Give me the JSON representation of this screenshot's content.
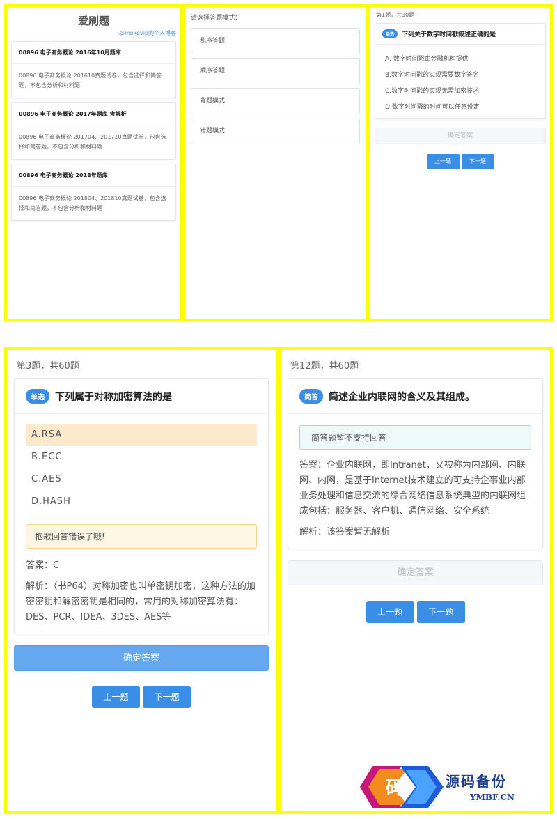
{
  "screen1": {
    "app_title": "爱刷题",
    "subtitle": "@mokevip的个人博客",
    "banks": [
      {
        "title": "00896 电子商务概论 2016年10月题库",
        "desc": "00896 电子商务概论 201610真题试卷，包含选择和简答题，不包含分析和材料题"
      },
      {
        "title": "00896 电子商务概论 2017年题库 含解析",
        "desc": "00896 电子商务概论 201704、201710真题试卷，包含选择和简答题，不包含分析和材料题"
      },
      {
        "title": "00896 电子商务概论 2018年题库",
        "desc": "00896 电子商务概论 201804、201810真题试卷，包含选择和简答题，不包含分析和材料题"
      }
    ]
  },
  "screen2": {
    "prompt": "请选择答题模式：",
    "modes": [
      "乱序答题",
      "顺序答题",
      "背题模式",
      "错题模式"
    ]
  },
  "screen3": {
    "counter": "第1题，共30题",
    "tag": "单选",
    "question": "下列关于数字时间戳叙述正确的是",
    "options": [
      "A. 数字时间戳由金融机构提供",
      "B.数字时间戳的实现需要数字签名",
      "C.数字时间戳的实现无需加密技术",
      "D.数字时间戳的时间可以任意设定"
    ],
    "confirm": "确定答案",
    "prev": "上一题",
    "next": "下一题"
  },
  "screen4": {
    "counter": "第3题，共60题",
    "tag": "单选",
    "question": "下列属于对称加密算法的是",
    "options": [
      "A.RSA",
      "B.ECC",
      "C.AES",
      "D.HASH"
    ],
    "selected_index": 0,
    "feedback": "抱歉回答错误了哦!",
    "answer": "答案：C",
    "analysis": "解析：（书P64）对称加密也叫单密钥加密，这种方法的加密密钥和解密密钥是相同的，常用的对称加密算法有：DES、PCR、IDEA、3DES、AES等",
    "confirm": "确定答案",
    "prev": "上一题",
    "next": "下一题"
  },
  "screen5": {
    "counter": "第12题，共60题",
    "tag": "简答",
    "question": "简述企业内联网的含义及其组成。",
    "notice": "简答题暂不支持回答",
    "answer": "答案：企业内联网，即Intranet，又被称为内部网、内联网、内网，是基于Internet技术建立的可支持企事业内部业务处理和信息交流的综合网络信息系统典型的内联网组成包括：服务器、客户机、通信网络、安全系统",
    "analysis": "解析：该答案暂无解析",
    "confirm": "确定答案",
    "prev": "上一题",
    "next": "下一题"
  },
  "watermark": {
    "glyph": "码",
    "title": "源码备份",
    "url": "YMBF.CN"
  },
  "colors": {
    "frame": "#ffff00",
    "primary": "#3a8ee6",
    "wrong_bg": "#fde9cc"
  }
}
